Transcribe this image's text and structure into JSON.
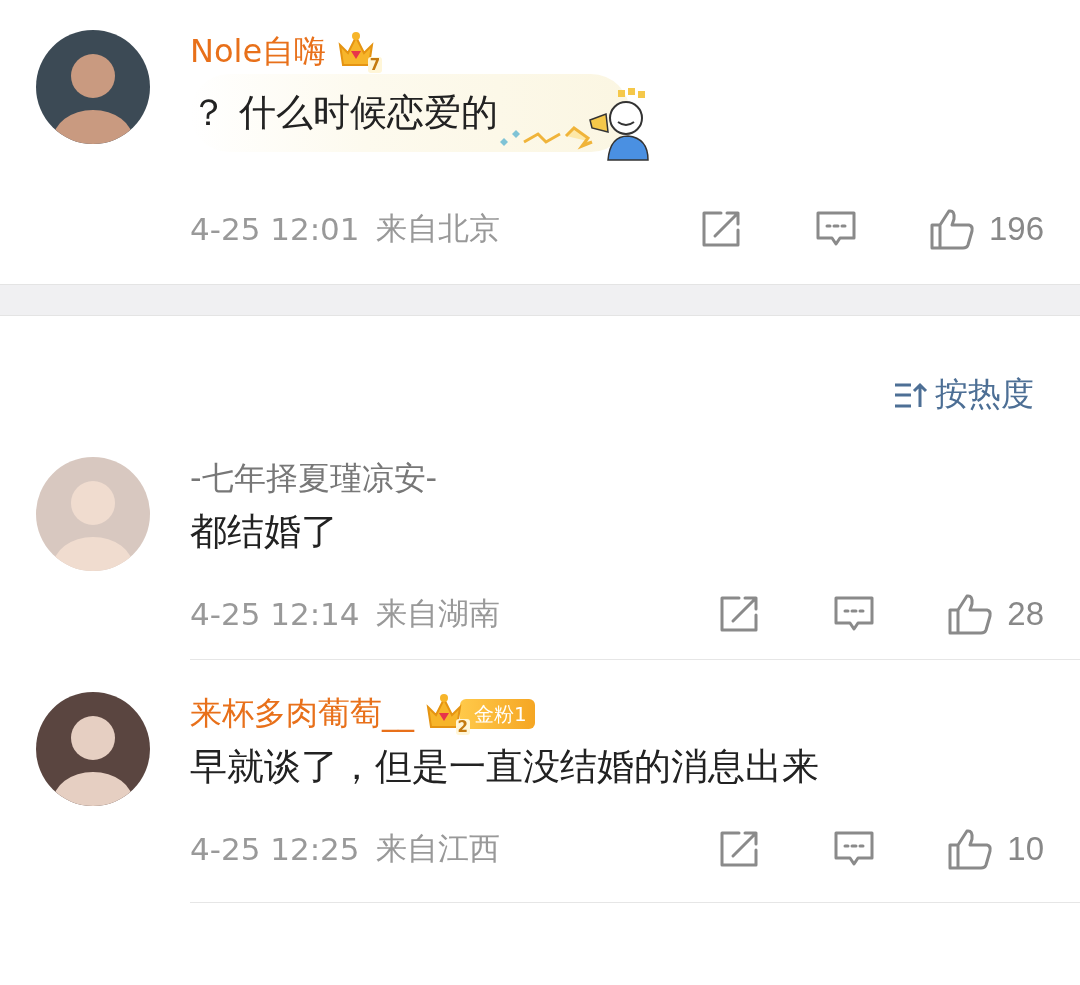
{
  "post": {
    "user": {
      "name": "Nole自嗨",
      "vip": true,
      "crown_level": "7"
    },
    "text": "？ 什么时候恋爱的",
    "has_sticker_bubble": true,
    "time": "4-25 12:01",
    "location": "来自北京",
    "likes": "196"
  },
  "sort": {
    "label": "按热度"
  },
  "comments": [
    {
      "user": {
        "name": "-七年择夏瑾凉安-",
        "vip": false
      },
      "text": "都结婚了",
      "time": "4-25 12:14",
      "location": "来自湖南",
      "likes": "28"
    },
    {
      "user": {
        "name": "来杯多肉葡萄__",
        "vip": true,
        "crown_level": "2",
        "fan_badge": "金粉1"
      },
      "text": "早就谈了，但是一直没结婚的消息出来",
      "time": "4-25 12:25",
      "location": "来自江西",
      "likes": "10"
    }
  ]
}
